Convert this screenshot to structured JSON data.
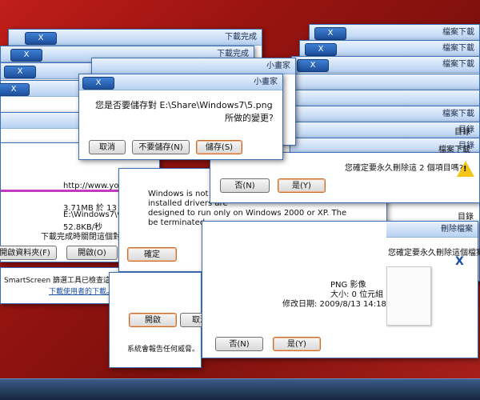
{
  "windows": {
    "top_left_title": "下載完成",
    "left_2_title": "下載完成",
    "center_title": "小畫家",
    "right_titles": [
      "檔案下載",
      "檔案下載",
      "檔案下載",
      "目錄",
      "目錄",
      "檔案下載",
      "檔案下載"
    ],
    "right_list_labels": [
      "目錄",
      "目錄",
      "檔案下載",
      "目錄",
      "檔案下載"
    ]
  },
  "center_dialog": {
    "message_line1": "您是否要儲存對 E:\\Share\\Windows7\\5.png",
    "message_line2": "所做的變更?",
    "save_label": "儲存(S)",
    "dont_save_label": "不要儲存(N)",
    "cancel_label": "取消"
  },
  "folder_dialog": {
    "question": "您確定要永久刪除這 2 個項目嗎?",
    "yes_label": "是(Y)",
    "no_label": "否(N)"
  },
  "compat_dialog": {
    "line1": "Windows is not Windows",
    "line2": "installed drivers are",
    "line3": "designed to run only on Windows 2000 or XP. The",
    "line4": "be terminated",
    "ok_label": "確定"
  },
  "download_info": {
    "url": "http://www.youtube.com",
    "size_line": "3.71MB 於 13 秒",
    "path_line": "E:\\Windows7\\video.flv",
    "speed_line": "52.8KB/秒",
    "close_checkbox": "下載完成時關閉這個對話方塊(C)",
    "open_folder_label": "開啟資料夾(F)",
    "open_label": "開啟(O)"
  },
  "smartscreen": {
    "line1": "SmartScreen 篩選工具已檢查這個下載。變更設定",
    "link": "下載使用者的下載。",
    "icon_glyph": "✎"
  },
  "small_dialog": {
    "open_label": "開啟",
    "cancel_label": "取消",
    "footer": "系統會報告任何威脅。 檢查"
  },
  "delete_file_dialog": {
    "title": "刪除檔案",
    "question": "您確定要永久刪除這個檔案嗎?",
    "file_type": "PNG 影像",
    "size": "大小: 0 位元組",
    "modified": "修改日期: 2009/8/13 14:18",
    "yes_label": "是(Y)",
    "no_label": "否(N)"
  },
  "close_glyph": "X",
  "warning_glyph": "!"
}
